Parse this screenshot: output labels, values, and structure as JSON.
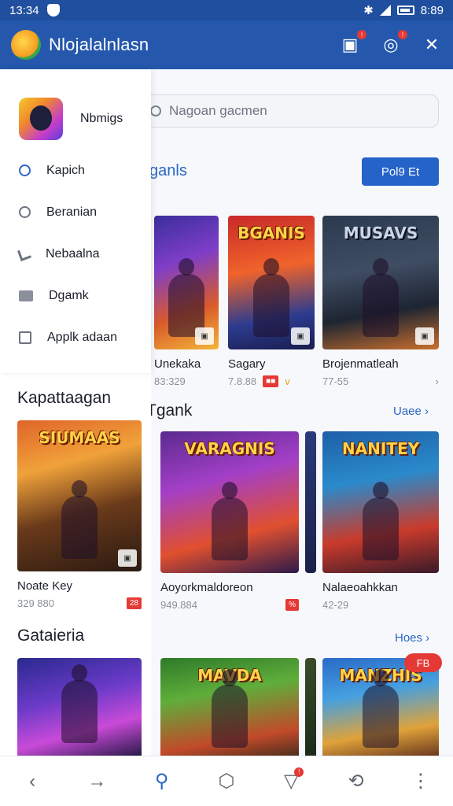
{
  "status_bar": {
    "time": "13:34",
    "clock_right": "8:89"
  },
  "app_bar": {
    "title": "Nlojalalnlasn",
    "icons": [
      "gift-icon",
      "chat-icon",
      "share-icon"
    ]
  },
  "drawer": {
    "name": "Nbmigs",
    "items": [
      {
        "label": "Kapich",
        "icon": "search-icon",
        "active": true
      },
      {
        "label": "Beranian",
        "icon": "search-icon"
      },
      {
        "label": "Nebaalna",
        "icon": "tools-icon"
      },
      {
        "label": "Dgamk",
        "icon": "image-icon"
      },
      {
        "label": "Applk adaan",
        "icon": "box-icon"
      }
    ]
  },
  "search": {
    "placeholder": "Nagoan gacmen"
  },
  "section1": {
    "title": "ganls",
    "button": "Pol9 Et"
  },
  "row1": [
    {
      "name": "Unekaka",
      "meta": "83:329",
      "thumb_title": ""
    },
    {
      "name": "Sagary",
      "meta": "7.8.88",
      "thumb_title": "BGANIS"
    },
    {
      "name": "Brojenmatleah",
      "meta": "77-55",
      "thumb_title": "MUSAVS"
    }
  ],
  "row2": {
    "title_left": "Kapattaagan",
    "title": "Tgank",
    "link": "Uaee ›",
    "items": [
      {
        "name": "Noate Key",
        "meta": "329 880",
        "thumb_title": "SIUMAAS",
        "badge": "28"
      },
      {
        "name": "Aoyorkmaldoreon",
        "meta": "949.884",
        "thumb_title": "VARAGNIS",
        "badge": "%"
      },
      {
        "name": "Nalaeoahkkan",
        "meta": "42-29",
        "thumb_title": "NANITEY"
      }
    ]
  },
  "row3": {
    "title": "Gataieria",
    "link": "Hoes ›",
    "hot_badge": "FB",
    "items": [
      {
        "thumb_title": ""
      },
      {
        "thumb_title": "MAVDA"
      },
      {
        "thumb_title": "MANZHIS"
      }
    ]
  },
  "bottom_nav": [
    "back-icon",
    "forward-icon",
    "profile-icon",
    "shield-icon",
    "messages-icon",
    "sync-icon",
    "more-icon"
  ]
}
